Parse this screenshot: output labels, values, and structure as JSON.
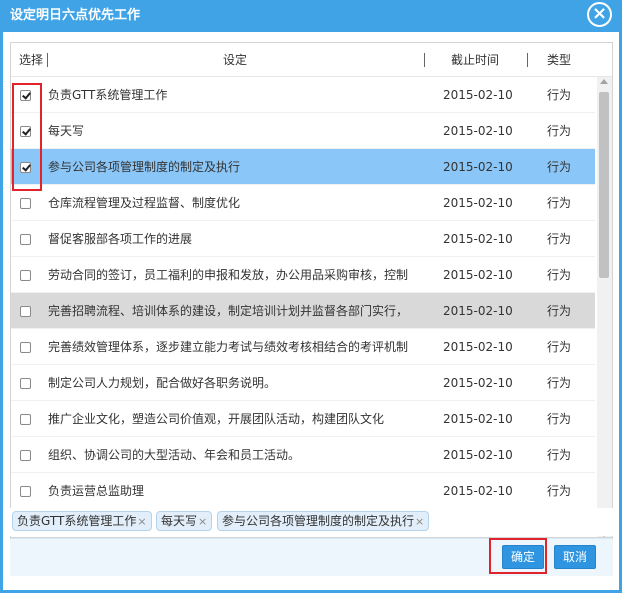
{
  "dialog": {
    "title": "设定明日六点优先工作",
    "close_glyph": "×"
  },
  "grid": {
    "columns": {
      "select": "选择",
      "setting": "设定",
      "deadline": "截止时间",
      "type": "类型"
    },
    "rows": [
      {
        "checked": true,
        "name": "负责GTT系统管理工作",
        "date": "2015-02-10",
        "type": "行为",
        "state": ""
      },
      {
        "checked": true,
        "name": "每天写",
        "date": "2015-02-10",
        "type": "行为",
        "state": ""
      },
      {
        "checked": true,
        "name": "参与公司各项管理制度的制定及执行",
        "date": "2015-02-10",
        "type": "行为",
        "state": "selected"
      },
      {
        "checked": false,
        "name": "仓库流程管理及过程监督、制度优化",
        "date": "2015-02-10",
        "type": "行为",
        "state": ""
      },
      {
        "checked": false,
        "name": "督促客服部各项工作的进展",
        "date": "2015-02-10",
        "type": "行为",
        "state": ""
      },
      {
        "checked": false,
        "name": "劳动合同的签订，员工福利的申报和发放，办公用品采购审核，控制",
        "date": "2015-02-10",
        "type": "行为",
        "state": ""
      },
      {
        "checked": false,
        "name": "完善招聘流程、培训体系的建设，制定培训计划并监督各部门实行，",
        "date": "2015-02-10",
        "type": "行为",
        "state": "hover"
      },
      {
        "checked": false,
        "name": "完善绩效管理体系，逐步建立能力考试与绩效考核相结合的考评机制",
        "date": "2015-02-10",
        "type": "行为",
        "state": ""
      },
      {
        "checked": false,
        "name": "制定公司人力规划，配合做好各职务说明。",
        "date": "2015-02-10",
        "type": "行为",
        "state": ""
      },
      {
        "checked": false,
        "name": "推广企业文化，塑造公司价值观，开展团队活动，构建团队文化",
        "date": "2015-02-10",
        "type": "行为",
        "state": ""
      },
      {
        "checked": false,
        "name": "组织、协调公司的大型活动、年会和员工活动。",
        "date": "2015-02-10",
        "type": "行为",
        "state": ""
      },
      {
        "checked": false,
        "name": "负责运营总监助理",
        "date": "2015-02-10",
        "type": "行为",
        "state": ""
      }
    ]
  },
  "selected_tags": [
    {
      "label": "负责GTT系统管理工作",
      "remove": "×"
    },
    {
      "label": "每天写",
      "remove": "×"
    },
    {
      "label": "参与公司各项管理制度的制定及执行",
      "remove": "×"
    }
  ],
  "footer": {
    "confirm_label": "确定",
    "cancel_label": "取消"
  },
  "colors": {
    "titlebar": "#3fa3e6",
    "selected_row": "#8ac6f7",
    "hover_row": "#d9d9d9",
    "button": "#2f95e0",
    "highlight": "#e0242a"
  }
}
